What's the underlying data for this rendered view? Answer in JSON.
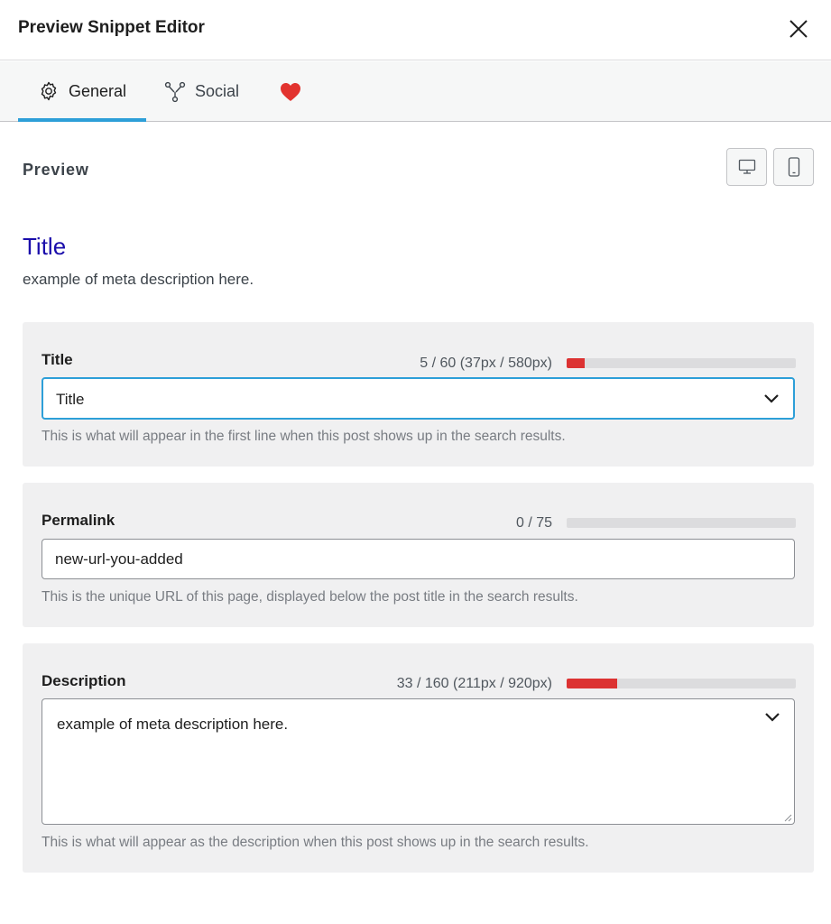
{
  "header": {
    "title": "Preview Snippet Editor"
  },
  "tabs": [
    {
      "label": "General",
      "active": true,
      "icon": "gear-icon"
    },
    {
      "label": "Social",
      "active": false,
      "icon": "share-icon"
    },
    {
      "label": "",
      "icon": "heart-icon"
    }
  ],
  "preview": {
    "label": "Preview",
    "serp_title": "Title",
    "serp_description": "example of meta description here."
  },
  "fields": {
    "title": {
      "label": "Title",
      "counter": "5 / 60 (37px / 580px)",
      "progress": 0.08,
      "value": "Title",
      "help": "This is what will appear in the first line when this post shows up in the search results."
    },
    "permalink": {
      "label": "Permalink",
      "counter": "0 / 75",
      "progress": 0,
      "value": "new-url-you-added",
      "help": "This is the unique URL of this page, displayed below the post title in the search results."
    },
    "description": {
      "label": "Description",
      "counter": "33 / 160 (211px / 920px)",
      "progress": 0.22,
      "value": "example of meta description here.",
      "help": "This is what will appear as the description when this post shows up in the search results."
    }
  },
  "colors": {
    "accent": "#2d9fd8",
    "progress_bad": "#dc3232",
    "serp_link": "#1a0dab",
    "heart": "#e2332f"
  }
}
